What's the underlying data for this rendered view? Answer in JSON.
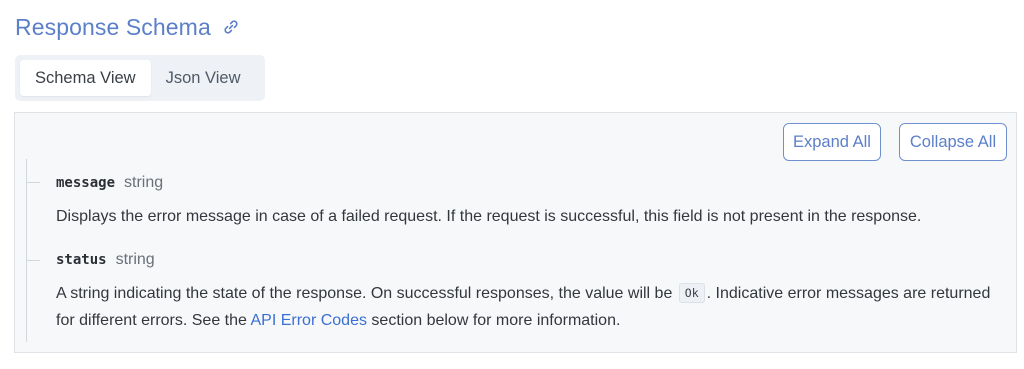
{
  "section": {
    "title": "Response Schema",
    "link_icon": "link-icon"
  },
  "tabs": [
    {
      "label": "Schema View",
      "active": true
    },
    {
      "label": "Json View",
      "active": false
    }
  ],
  "toolbar": {
    "expand_label": "Expand All",
    "collapse_label": "Collapse All"
  },
  "properties": [
    {
      "name": "message",
      "type": "string",
      "description": "Displays the error message in case of a failed request. If the request is successful, this field is not present in the response."
    },
    {
      "name": "status",
      "type": "string",
      "description_part1": "A string indicating the state of the response. On successful responses, the value will be",
      "code": "Ok",
      "description_part2": ". Indicative error messages are returned for different errors. See the",
      "link_text": "API Error Codes",
      "description_part3": "section below for more information."
    }
  ],
  "colors": {
    "accent": "#5b7fc9",
    "link": "#3b6fd1",
    "panel_bg": "#f7f8fa",
    "tabs_bg": "#eef2f7"
  }
}
